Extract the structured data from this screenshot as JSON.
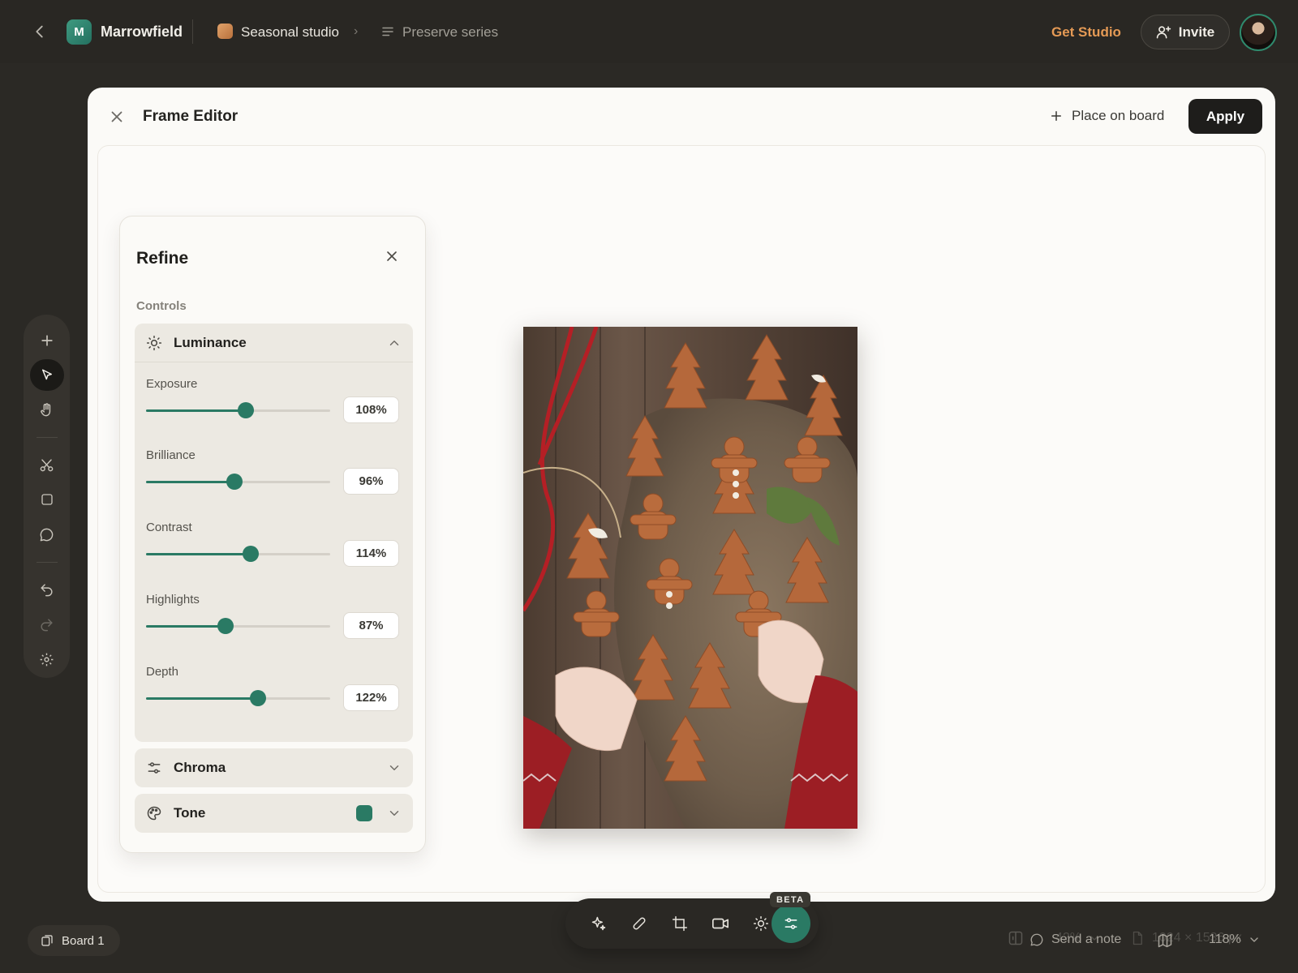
{
  "topbar": {
    "app_name": "Marrowfield",
    "logo_letter": "M",
    "studio": "Seasonal studio",
    "separator": "›",
    "series": "Preserve series",
    "get_studio": "Get Studio",
    "invite": "Invite"
  },
  "rail": {
    "tools": [
      "plus-icon",
      "pointer-icon",
      "hand-icon",
      "scissors-icon",
      "square-icon",
      "comment-icon",
      "undo-icon",
      "redo-icon",
      "settings-icon"
    ],
    "active_tool": "pointer-icon"
  },
  "modal": {
    "title": "Frame Editor",
    "place_on_board": "Place on board",
    "apply": "Apply"
  },
  "refine": {
    "title": "Refine",
    "controls_label": "Controls",
    "luminance": {
      "label": "Luminance",
      "expanded": true,
      "sliders": [
        {
          "label": "Exposure",
          "value": "108%",
          "position": 0.54
        },
        {
          "label": "Brilliance",
          "value": "96%",
          "position": 0.48
        },
        {
          "label": "Contrast",
          "value": "114%",
          "position": 0.57
        },
        {
          "label": "Highlights",
          "value": "87%",
          "position": 0.43
        },
        {
          "label": "Depth",
          "value": "122%",
          "position": 0.61
        }
      ]
    },
    "chroma": {
      "label": "Chroma",
      "expanded": false
    },
    "tone": {
      "label": "Tone",
      "expanded": false,
      "swatch_color": "#2a7a64"
    }
  },
  "toolbar": {
    "tools": [
      "sparkle-icon",
      "bandage-icon",
      "crop-icon",
      "video-icon",
      "brightness-icon",
      "adjust-sliders-icon"
    ],
    "active_tool": "adjust-sliders-icon",
    "beta_badge": "BETA"
  },
  "canvas_footer": {
    "zoom": "42%",
    "dimensions": "1024 × 1536 px"
  },
  "bottombar": {
    "board": "Board 1",
    "send_note": "Send a note",
    "zoom": "118%"
  },
  "colors": {
    "accent": "#2a7a64",
    "brand_orange": "#e59a55",
    "dark_bg": "#2b2925"
  }
}
